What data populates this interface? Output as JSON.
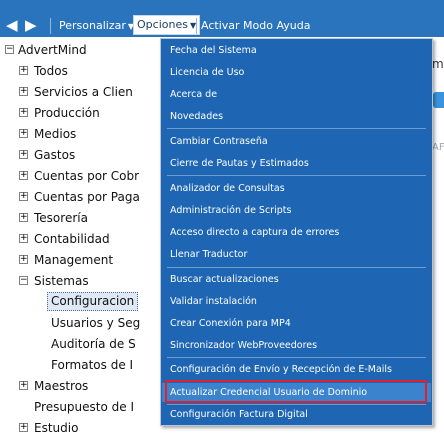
{
  "toolbar": {
    "personalizar_label": "Personalizar",
    "opciones_label": "Opciones",
    "ayuda_label": "Activar Modo Ayuda"
  },
  "tree": {
    "root": "AdvertMind",
    "items": [
      {
        "label": "Todos",
        "expander": "+"
      },
      {
        "label": "Servicios a Clien",
        "expander": "+"
      },
      {
        "label": "Producción",
        "expander": "+"
      },
      {
        "label": "Medios",
        "expander": "+"
      },
      {
        "label": "Gastos",
        "expander": "+"
      },
      {
        "label": "Cuentas por Cobr",
        "expander": "+"
      },
      {
        "label": "Cuentas por Paga",
        "expander": "+"
      },
      {
        "label": "Tesorería",
        "expander": "+"
      },
      {
        "label": "Contabilidad",
        "expander": "+"
      },
      {
        "label": "Management",
        "expander": "+"
      },
      {
        "label": "Sistemas",
        "expander": "−"
      }
    ],
    "sistemas_children": [
      "Configuracion",
      "Usuarios y Seg",
      "Auditoría de S",
      "Formatos de I"
    ],
    "after_items": [
      {
        "label": "Maestros",
        "expander": "+"
      },
      {
        "label": "Presupuesto de I",
        "expander": ""
      },
      {
        "label": "Estudio",
        "expander": "+"
      }
    ],
    "root_expander": "−"
  },
  "right_panel": {
    "text1": "ma",
    "text2": "AF"
  },
  "menu": {
    "items": [
      "Fecha del Sistema",
      "Licencia de Uso",
      "Acerca de",
      "Novedades",
      "Cambiar Contraseña",
      "Cierre de Pautas y Estimados",
      "Analizador de Consultas",
      "Administración de Scripts",
      "Acceso directo a captura de errores",
      "Llenar Traductor",
      "Buscar actualizaciones",
      "Validar instalación",
      "Crear Conexión para MP4",
      "Sincronizador WebProveedores",
      "Configuración de Envío y Recepción de E-Mails",
      "Actualizar Credencial Usuario de Dominio",
      "Configuración Factura Digital"
    ],
    "highlighted_index": 15
  },
  "colors": {
    "toolbar_bg": "#2a74be",
    "menu_bg": "#1e66b4",
    "highlight_border": "#e0202a"
  }
}
